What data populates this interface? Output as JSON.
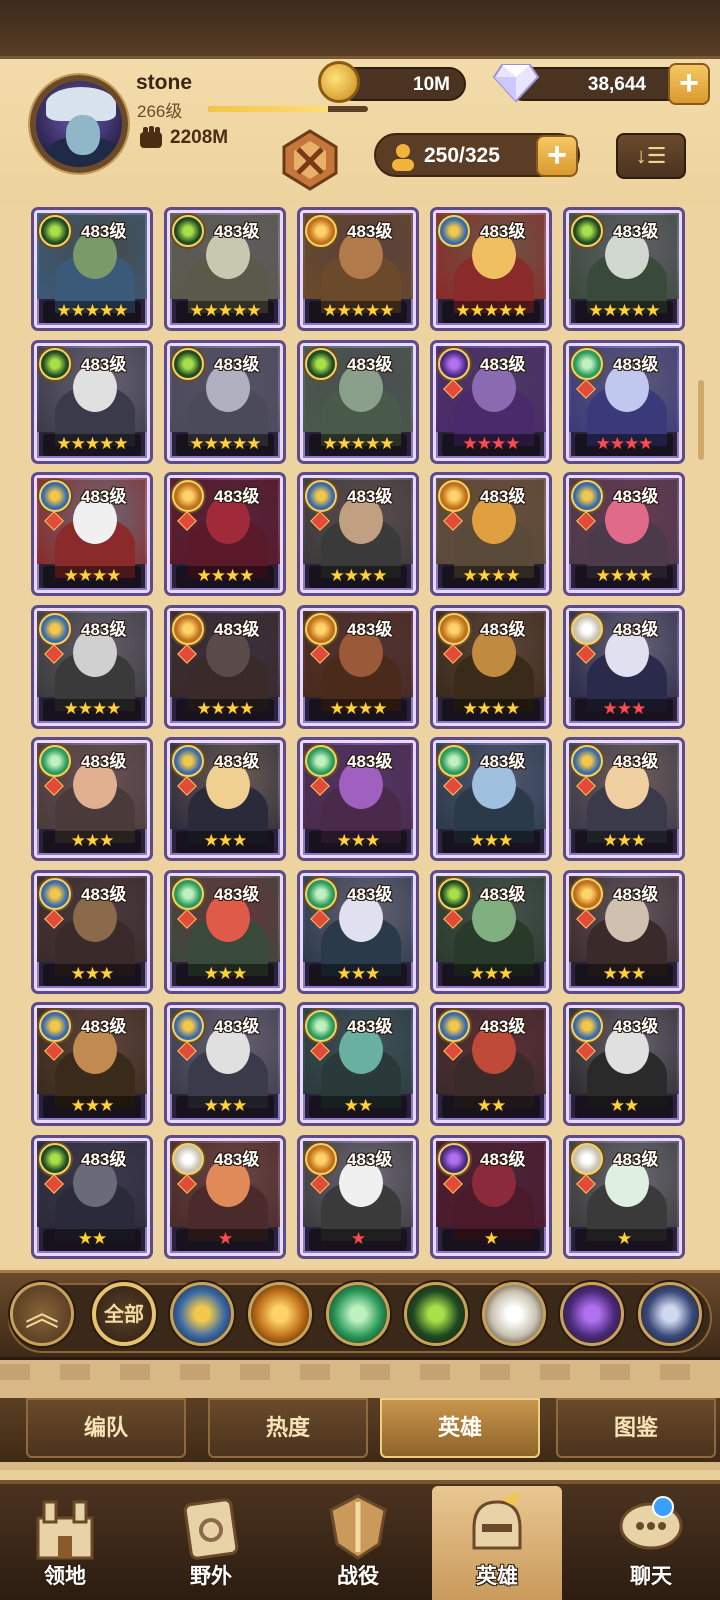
{
  "player": {
    "name": "stone",
    "level": "266级",
    "xp_fraction": 0.75,
    "power": "2208M"
  },
  "resources": {
    "gold": "10M",
    "gems": "38,644"
  },
  "hero_count": "250/325",
  "sort_glyph": "↓☰",
  "heroes": [
    {
      "level": "483级",
      "stars": "★★★★★",
      "star_color": "gold",
      "faction": "forest",
      "art": [
        "#3b5a7a",
        "#7a9a6a"
      ]
    },
    {
      "level": "483级",
      "stars": "★★★★★",
      "star_color": "gold",
      "faction": "forest",
      "art": [
        "#5a5a4a",
        "#c8c8b0"
      ]
    },
    {
      "level": "483级",
      "stars": "★★★★★",
      "star_color": "gold",
      "faction": "fire",
      "art": [
        "#6a4a2a",
        "#b07a4a"
      ]
    },
    {
      "level": "483级",
      "stars": "★★★★★",
      "star_color": "gold",
      "faction": "light",
      "art": [
        "#8a2a2a",
        "#f0c060"
      ]
    },
    {
      "level": "483级",
      "stars": "★★★★★",
      "star_color": "gold",
      "faction": "forest",
      "art": [
        "#3a4a3a",
        "#d0d8d0"
      ]
    },
    {
      "level": "483级",
      "stars": "★★★★★",
      "star_color": "gold",
      "faction": "forest",
      "art": [
        "#3a3a4a",
        "#e0e0e0"
      ]
    },
    {
      "level": "483级",
      "stars": "★★★★★",
      "star_color": "gold",
      "faction": "forest",
      "art": [
        "#4a4a5a",
        "#b0b0c0"
      ]
    },
    {
      "level": "483级",
      "stars": "★★★★★",
      "star_color": "gold",
      "faction": "forest",
      "art": [
        "#4a5a4a",
        "#8aa08a"
      ]
    },
    {
      "level": "483级",
      "stars": "★★★★",
      "star_color": "red",
      "faction": "dark",
      "art": [
        "#4a2a6a",
        "#8a6ab0"
      ]
    },
    {
      "level": "483级",
      "stars": "★★★★",
      "star_color": "red",
      "faction": "nature",
      "art": [
        "#3a3a7a",
        "#c0c8f0"
      ]
    },
    {
      "level": "483级",
      "stars": "★★★★",
      "star_color": "gold",
      "faction": "light",
      "art": [
        "#8a2a2a",
        "#f0f0f0"
      ]
    },
    {
      "level": "483级",
      "stars": "★★★★",
      "star_color": "gold",
      "faction": "fire",
      "art": [
        "#5a1a2a",
        "#a02a3a"
      ]
    },
    {
      "level": "483级",
      "stars": "★★★★",
      "star_color": "gold",
      "faction": "light",
      "art": [
        "#3a3a3a",
        "#c0a080"
      ]
    },
    {
      "level": "483级",
      "stars": "★★★★",
      "star_color": "gold",
      "faction": "fire",
      "art": [
        "#5a4a3a",
        "#e0a040"
      ]
    },
    {
      "level": "483级",
      "stars": "★★★★",
      "star_color": "gold",
      "faction": "light",
      "art": [
        "#4a3a4a",
        "#e06a8a"
      ]
    },
    {
      "level": "483级",
      "stars": "★★★★",
      "star_color": "gold",
      "faction": "light",
      "art": [
        "#3a3a3a",
        "#d0d0d0"
      ]
    },
    {
      "level": "483级",
      "stars": "★★★★",
      "star_color": "gold",
      "faction": "fire",
      "art": [
        "#3a2a2a",
        "#5a4a4a"
      ]
    },
    {
      "level": "483级",
      "stars": "★★★★",
      "star_color": "gold",
      "faction": "fire",
      "art": [
        "#4a2a1a",
        "#9a5a3a"
      ]
    },
    {
      "level": "483级",
      "stars": "★★★★",
      "star_color": "gold",
      "faction": "fire",
      "art": [
        "#3a2a1a",
        "#c08a40"
      ]
    },
    {
      "level": "483级",
      "stars": "★★★",
      "star_color": "red",
      "faction": "celestial",
      "art": [
        "#2a2a4a",
        "#e0e0f0"
      ]
    },
    {
      "level": "483级",
      "stars": "★★★",
      "star_color": "gold",
      "faction": "nature",
      "art": [
        "#4a3a3a",
        "#e0b090"
      ]
    },
    {
      "level": "483级",
      "stars": "★★★",
      "star_color": "gold",
      "faction": "light",
      "art": [
        "#2a2a3a",
        "#f0d090"
      ]
    },
    {
      "level": "483级",
      "stars": "★★★",
      "star_color": "gold",
      "faction": "nature",
      "art": [
        "#4a2a4a",
        "#a060c0"
      ]
    },
    {
      "level": "483级",
      "stars": "★★★",
      "star_color": "gold",
      "faction": "nature",
      "art": [
        "#2a3a4a",
        "#a0c0e0"
      ]
    },
    {
      "level": "483级",
      "stars": "★★★",
      "star_color": "gold",
      "faction": "light",
      "art": [
        "#3a3a4a",
        "#f0d0a0"
      ]
    },
    {
      "level": "483级",
      "stars": "★★★",
      "star_color": "gold",
      "faction": "light",
      "art": [
        "#3a2a2a",
        "#8a6a4a"
      ]
    },
    {
      "level": "483级",
      "stars": "★★★",
      "star_color": "gold",
      "faction": "nature",
      "art": [
        "#3a4a3a",
        "#e05a4a"
      ]
    },
    {
      "level": "483级",
      "stars": "★★★",
      "star_color": "gold",
      "faction": "nature",
      "art": [
        "#2a3a4a",
        "#e0e0f0"
      ]
    },
    {
      "level": "483级",
      "stars": "★★★",
      "star_color": "gold",
      "faction": "forest",
      "art": [
        "#2a3a2a",
        "#80b080"
      ]
    },
    {
      "level": "483级",
      "stars": "★★★",
      "star_color": "gold",
      "faction": "fire",
      "art": [
        "#3a2a2a",
        "#d0c0b0"
      ]
    },
    {
      "level": "483级",
      "stars": "★★★",
      "star_color": "gold",
      "faction": "light",
      "art": [
        "#3a2a1a",
        "#c08a50"
      ]
    },
    {
      "level": "483级",
      "stars": "★★★",
      "star_color": "gold",
      "faction": "light",
      "art": [
        "#3a3a4a",
        "#e0e0e0"
      ]
    },
    {
      "level": "483级",
      "stars": "★★",
      "star_color": "gold",
      "faction": "nature",
      "art": [
        "#2a3a3a",
        "#6ab0a0"
      ]
    },
    {
      "level": "483级",
      "stars": "★★",
      "star_color": "gold",
      "faction": "light",
      "art": [
        "#3a2a2a",
        "#c04a3a"
      ]
    },
    {
      "level": "483级",
      "stars": "★★",
      "star_color": "gold",
      "faction": "light",
      "art": [
        "#2a2a2a",
        "#e0e0e0"
      ]
    },
    {
      "level": "483级",
      "stars": "★★",
      "star_color": "gold",
      "faction": "forest",
      "art": [
        "#2a2a3a",
        "#6a6a7a"
      ]
    },
    {
      "level": "483级",
      "stars": "★",
      "star_color": "red",
      "faction": "celestial",
      "art": [
        "#4a2a2a",
        "#e08a5a"
      ]
    },
    {
      "level": "483级",
      "stars": "★",
      "star_color": "red",
      "faction": "fire",
      "art": [
        "#3a3a3a",
        "#f0f0f0"
      ]
    },
    {
      "level": "483级",
      "stars": "★",
      "star_color": "gold",
      "faction": "dark",
      "art": [
        "#4a1a2a",
        "#8a2a3a"
      ]
    },
    {
      "level": "483级",
      "stars": "★",
      "star_color": "gold",
      "faction": "celestial",
      "art": [
        "#3a3a3a",
        "#e0f0e0"
      ]
    }
  ],
  "filters": {
    "all_label": "全部",
    "factions": [
      {
        "name": "light",
        "color": "#3a6aa8",
        "accent": "#f2c84a"
      },
      {
        "name": "fire",
        "color": "#c0701a",
        "accent": "#ffd36a"
      },
      {
        "name": "nature",
        "color": "#2a9a5a",
        "accent": "#bff0c0"
      },
      {
        "name": "forest",
        "color": "#1f4a22",
        "accent": "#a8e04a"
      },
      {
        "name": "celestial",
        "color": "#c9c2b0",
        "accent": "#ffffff"
      },
      {
        "name": "dark",
        "color": "#4a2a7a",
        "accent": "#b070f0"
      },
      {
        "name": "mech",
        "color": "#3a4a7a",
        "accent": "#d0d8f0"
      }
    ]
  },
  "tabs": [
    "编队",
    "热度",
    "英雄",
    "图鉴"
  ],
  "active_tab": 2,
  "nav": [
    {
      "label": "领地",
      "icon": "castle-icon"
    },
    {
      "label": "野外",
      "icon": "scroll-map-icon"
    },
    {
      "label": "战役",
      "icon": "sword-shield-icon"
    },
    {
      "label": "英雄",
      "icon": "helmet-icon"
    },
    {
      "label": "聊天",
      "icon": "chat-icon"
    }
  ],
  "active_nav": 3
}
